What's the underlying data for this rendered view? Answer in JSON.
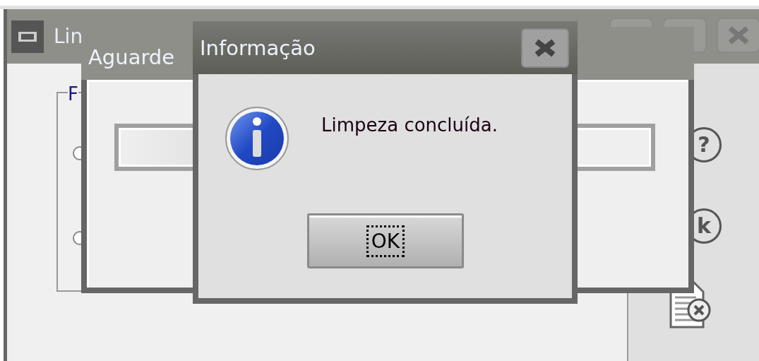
{
  "main_window": {
    "title": "Lin",
    "group": {
      "label": "F",
      "options": [
        {
          "checked": false
        },
        {
          "checked": false
        }
      ]
    },
    "side_buttons": [
      {
        "glyph": "?"
      },
      {
        "glyph": "k"
      }
    ]
  },
  "progress_window": {
    "title": "Aguarde"
  },
  "info_dialog": {
    "title": "Informação",
    "message": "Limpeza concluída.",
    "buttons": [
      {
        "label": "OK",
        "focused": true
      }
    ]
  }
}
